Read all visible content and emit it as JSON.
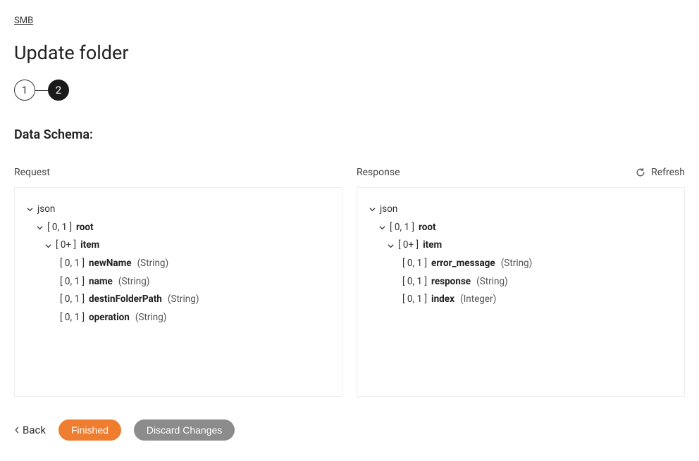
{
  "breadcrumb": {
    "label": "SMB"
  },
  "page": {
    "title": "Update folder",
    "section_title": "Data Schema:"
  },
  "stepper": {
    "step1": "1",
    "step2": "2"
  },
  "schema": {
    "request": {
      "label": "Request",
      "rootFormat": "json",
      "root": {
        "card": "[ 0, 1 ]",
        "name": "root"
      },
      "item": {
        "card": "[ 0+ ]",
        "name": "item"
      },
      "fields": [
        {
          "card": "[ 0, 1 ]",
          "name": "newName",
          "type": "(String)"
        },
        {
          "card": "[ 0, 1 ]",
          "name": "name",
          "type": "(String)"
        },
        {
          "card": "[ 0, 1 ]",
          "name": "destinFolderPath",
          "type": "(String)"
        },
        {
          "card": "[ 0, 1 ]",
          "name": "operation",
          "type": "(String)"
        }
      ]
    },
    "response": {
      "label": "Response",
      "refresh_label": "Refresh",
      "rootFormat": "json",
      "root": {
        "card": "[ 0, 1 ]",
        "name": "root"
      },
      "item": {
        "card": "[ 0+ ]",
        "name": "item"
      },
      "fields": [
        {
          "card": "[ 0, 1 ]",
          "name": "error_message",
          "type": "(String)"
        },
        {
          "card": "[ 0, 1 ]",
          "name": "response",
          "type": "(String)"
        },
        {
          "card": "[ 0, 1 ]",
          "name": "index",
          "type": "(Integer)"
        }
      ]
    }
  },
  "footer": {
    "back": "Back",
    "finished": "Finished",
    "discard": "Discard Changes"
  }
}
